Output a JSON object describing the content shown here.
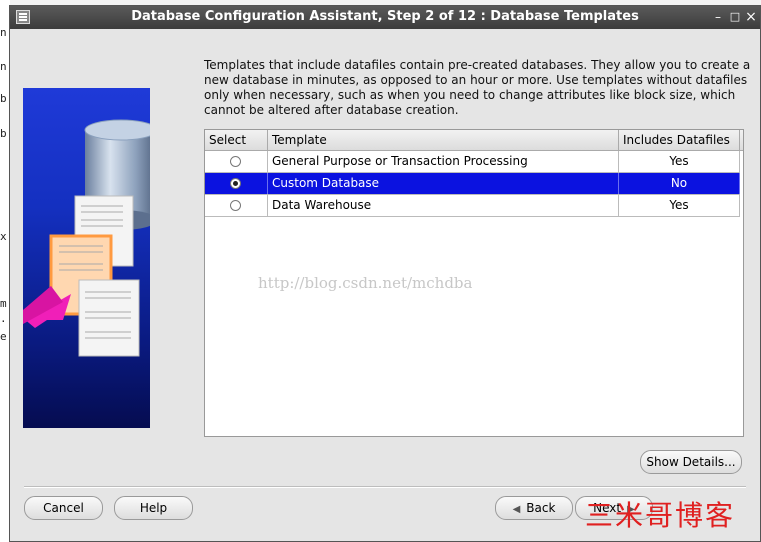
{
  "window": {
    "title": "Database Configuration Assistant, Step 2 of 12 : Database Templates",
    "minimize_label": "–",
    "maximize_label": "□",
    "close_label": "×"
  },
  "description": [
    "Templates that include datafiles contain pre-created databases. They allow you to create a",
    "new database in minutes, as opposed to an hour or more. Use templates without datafiles",
    "only when necessary, such as when you need to change attributes like block size, which",
    "cannot be altered after database creation."
  ],
  "table": {
    "headers": [
      "Select",
      "Template",
      "Includes Datafiles"
    ],
    "rows": [
      {
        "template": "General Purpose or Transaction Processing",
        "datafiles": "Yes",
        "selected": false
      },
      {
        "template": "Custom Database",
        "datafiles": "No",
        "selected": true
      },
      {
        "template": "Data Warehouse",
        "datafiles": "Yes",
        "selected": false
      }
    ]
  },
  "watermark": "http://blog.csdn.net/mchdba",
  "buttons": {
    "show_details": "Show Details...",
    "cancel": "Cancel",
    "help": "Help",
    "back": "Back",
    "next": "Next"
  },
  "brand_text": "三米哥博客",
  "background_terminal": [
    "n",
    "n",
    "b",
    "b",
    "x",
    "m",
    ".",
    "e"
  ],
  "colors": {
    "selection": "#0b12e0",
    "title_bar": "#3c3c3c",
    "dialog_bg": "#e5e5e5",
    "art_bg": "#1430c0",
    "brand": "#e02020"
  }
}
